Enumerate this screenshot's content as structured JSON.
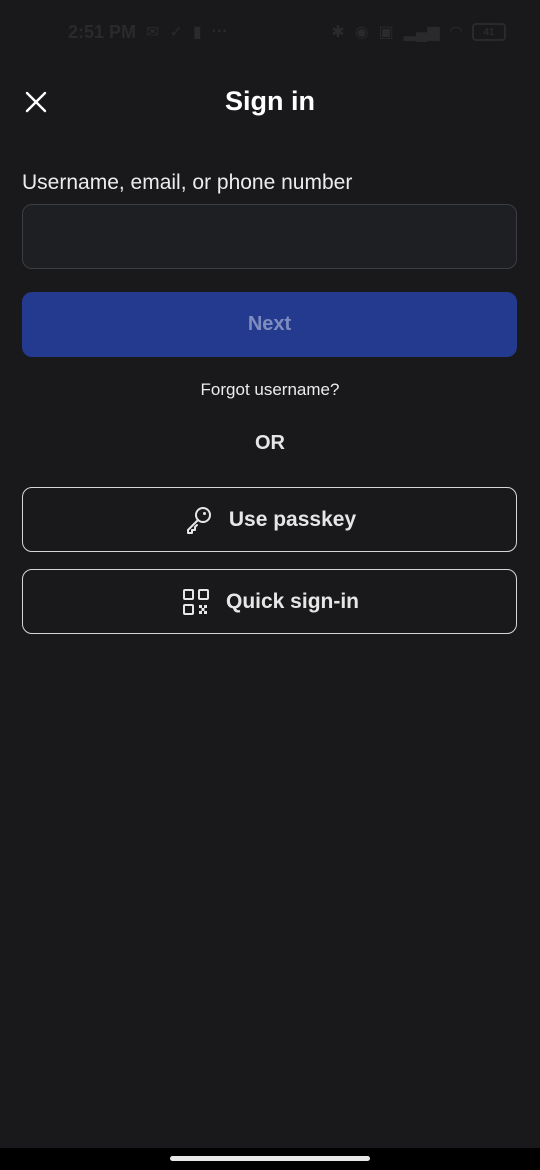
{
  "status_bar": {
    "time": "2:51 PM",
    "icons_left": [
      "mail-icon",
      "check-icon",
      "sim-icon",
      "more-icon"
    ],
    "icons_right": [
      "bluetooth-icon",
      "eye-icon",
      "sim-card-icon",
      "signal-icon",
      "wifi-icon"
    ],
    "battery": "41"
  },
  "header": {
    "title": "Sign in",
    "close_icon": "close-icon"
  },
  "form": {
    "field_label": "Username, email, or phone number",
    "input_value": "",
    "input_placeholder": "",
    "next_label": "Next",
    "forgot_label": "Forgot username?"
  },
  "divider": {
    "label": "OR"
  },
  "alternatives": {
    "passkey_label": "Use passkey",
    "passkey_icon": "key-icon",
    "quick_label": "Quick sign-in",
    "quick_icon": "qr-code-icon"
  },
  "colors": {
    "background": "#19191b",
    "primary_button": "#243a8f",
    "primary_button_text": "#7f8cc0",
    "outline_border": "#d6d6d6"
  }
}
